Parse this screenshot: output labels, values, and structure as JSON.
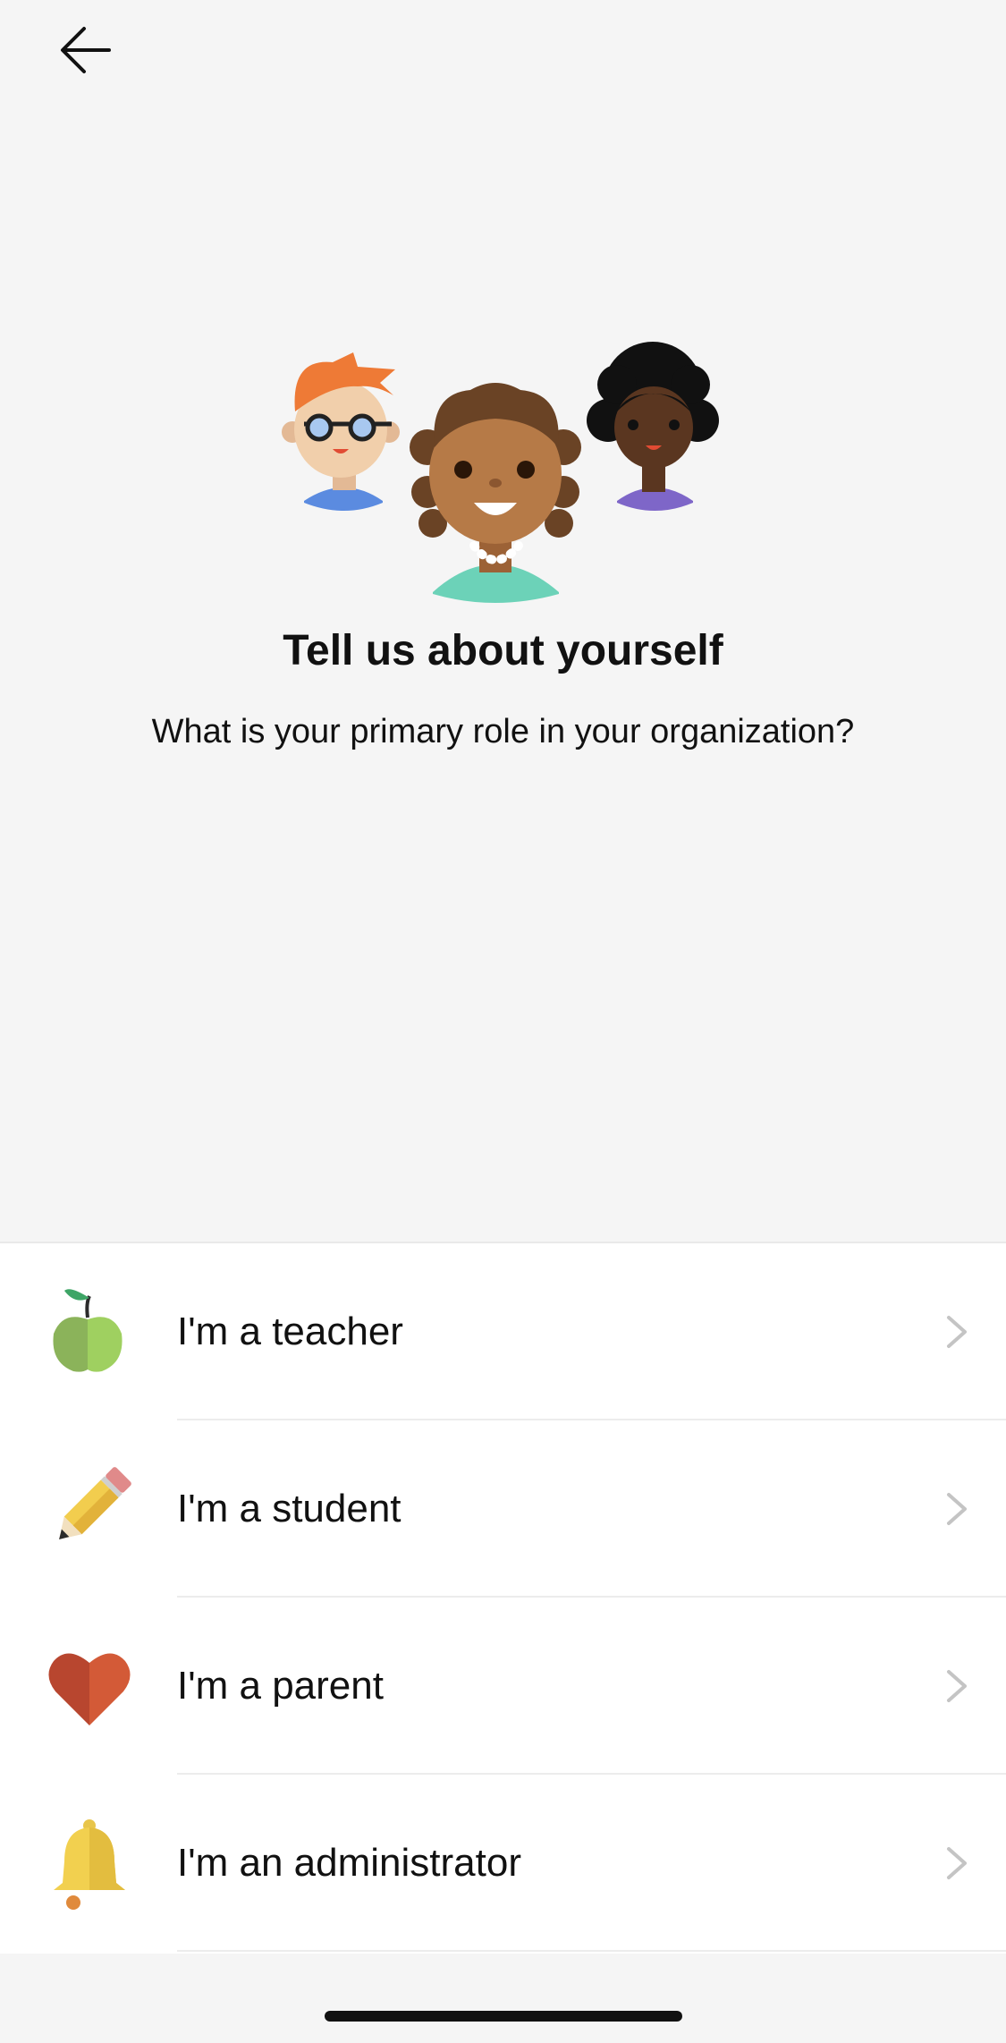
{
  "header": {
    "back_icon": "arrow-left-icon"
  },
  "hero": {
    "illustration": "three-people-avatars",
    "title": "Tell us about yourself",
    "subtitle": "What is your primary role in your organization?"
  },
  "roles": [
    {
      "label": "I'm a teacher",
      "icon": "apple-icon"
    },
    {
      "label": "I'm a student",
      "icon": "pencil-icon"
    },
    {
      "label": "I'm a parent",
      "icon": "heart-icon"
    },
    {
      "label": "I'm an administrator",
      "icon": "bell-icon"
    }
  ],
  "colors": {
    "background": "#f5f5f5",
    "list_background": "#ffffff",
    "chevron": "#c4c4c4"
  }
}
